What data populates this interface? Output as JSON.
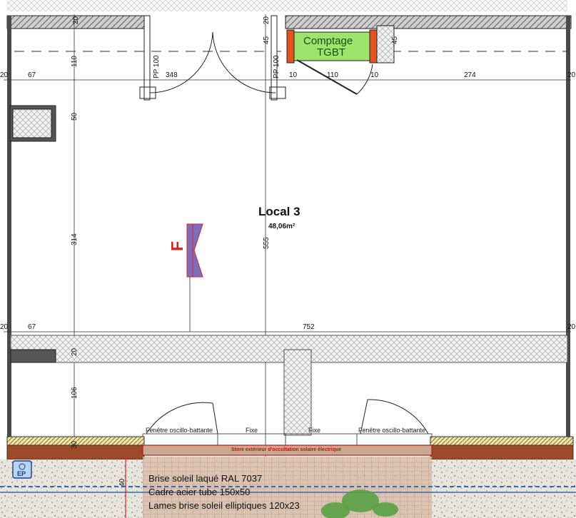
{
  "room": {
    "name": "Local 3",
    "area": "48,06m²"
  },
  "meter_room": {
    "line1": "Comptage",
    "line2": "TGBT"
  },
  "marker_letter": "F",
  "ep_label": "EP",
  "doors": {
    "left": "PP 100",
    "right": "PP 100"
  },
  "dims": {
    "top_left": "20",
    "top_mid": "20",
    "top_right_45a": "45",
    "top_right_45b": "45",
    "row_left_20": "20",
    "row_67": "67",
    "row_348": "348",
    "row_10a": "10",
    "row_110": "110",
    "row_10b": "10",
    "row_274": "274",
    "row_right_20": "20",
    "v_110": "110",
    "v_50": "50",
    "v_314": "314",
    "v_555": "555",
    "v_20": "20",
    "v_106": "106",
    "v_30": "30",
    "v_40": "40",
    "mid_left_20": "20",
    "mid_67": "67",
    "mid_752": "752",
    "mid_right_20": "20"
  },
  "windows": {
    "left": "Fenêtre oscillo-battante",
    "fixe1": "Fixe",
    "fixe2": "Fixe",
    "right": "Fenêtre oscillo-battante",
    "store": "Store extérieur d'occultation solaire électrique"
  },
  "notes": [
    "Brise soleil laqué RAL 7037",
    "Cadre acier tube 150x50",
    "Lames brise soleil elliptiques 120x23"
  ],
  "colors": {
    "wall_hatch": "#5a5a5a",
    "meter_fill": "#9ee36b",
    "orange": "#e2541c",
    "marker_fill": "#7a6fbf",
    "marker_red": "#e02020",
    "brick": "#9c4a28",
    "facade": "#c7a98f",
    "red_line": "#d42525"
  }
}
